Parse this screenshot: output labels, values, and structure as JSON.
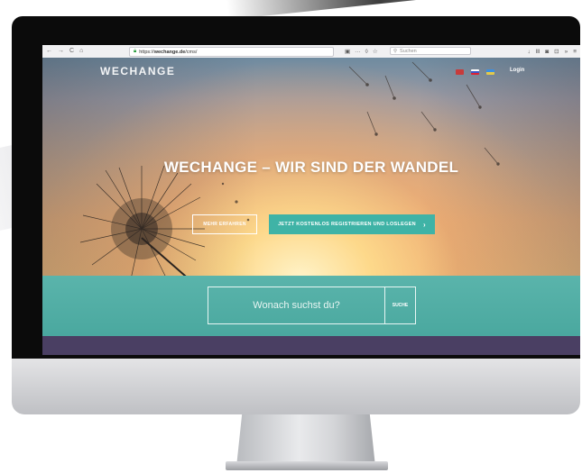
{
  "browser": {
    "url_prefix": "https://",
    "url_host": "wechange.de",
    "url_path": "/cms/",
    "search_placeholder": "Suchen",
    "nav_back": "←",
    "nav_forward": "→",
    "nav_reload": "C",
    "nav_home": "⌂",
    "url_menu": "···",
    "url_icon_reader": "▣",
    "url_icon_shield": "◊",
    "url_icon_star": "☆",
    "toolbar_download": "↓",
    "toolbar_library": "Ⅲ",
    "toolbar_sync": "◙",
    "toolbar_screenshot": "⊡",
    "toolbar_more": "»",
    "toolbar_menu": "≡"
  },
  "site": {
    "logo": "WECHANGE",
    "login": "Login",
    "languages": [
      {
        "code": "de",
        "color": "#c73b3b"
      },
      {
        "code": "ru",
        "color": "#3b56c7"
      },
      {
        "code": "uk",
        "color": "#e3c94a"
      }
    ]
  },
  "hero": {
    "headline": "WECHANGE – WIR SIND DER WANDEL",
    "btn_outline": "MEHR ERFAHREN",
    "btn_primary": "JETZT KOSTENLOS REGISTRIEREN UND LOSLEGEN",
    "btn_primary_icon": "›"
  },
  "search": {
    "placeholder": "Wonach suchst du?",
    "button": "SUCHE"
  },
  "colors": {
    "accent": "#3fb3a6",
    "band": "#4aa89f",
    "footer": "#4a3f63"
  }
}
